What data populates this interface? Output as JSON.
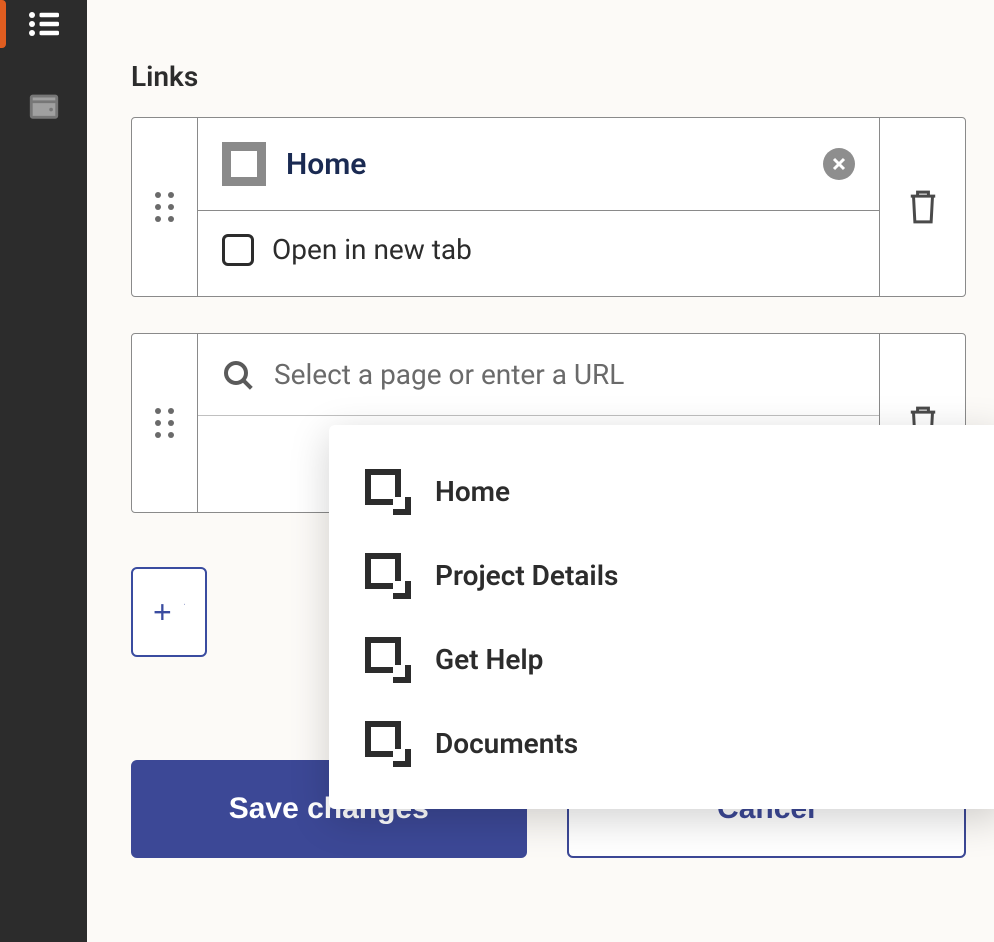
{
  "sidebar": {
    "items": [
      {
        "name": "list-icon"
      },
      {
        "name": "wallet-icon"
      }
    ]
  },
  "links": {
    "heading": "Links",
    "rows": [
      {
        "page_name": "Home",
        "open_new_tab_label": "Open in new tab",
        "has_value": true
      },
      {
        "placeholder": "Select a page or enter a URL",
        "has_value": false
      }
    ],
    "add_link_label": "Add link"
  },
  "dropdown": {
    "options": [
      {
        "label": "Home"
      },
      {
        "label": "Project Details"
      },
      {
        "label": "Get Help"
      },
      {
        "label": "Documents"
      }
    ]
  },
  "actions": {
    "save_label": "Save changes",
    "cancel_label": "Cancel"
  }
}
